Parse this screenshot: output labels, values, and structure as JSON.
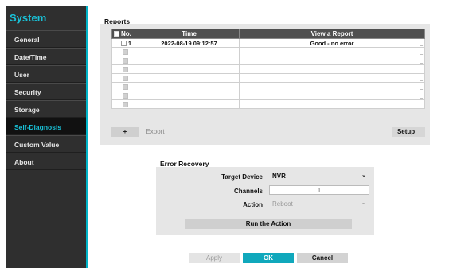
{
  "colors": {
    "accent": "#19c2d8",
    "sidebar_bg": "#2f2f2f",
    "ok_bg": "#10a8bc",
    "panel_bg": "#e6e6e6"
  },
  "sidebar": {
    "title": "System",
    "items": [
      {
        "label": "General"
      },
      {
        "label": "Date/Time"
      },
      {
        "label": "User"
      },
      {
        "label": "Security"
      },
      {
        "label": "Storage"
      },
      {
        "label": "Self-Diagnosis",
        "active": true
      },
      {
        "label": "Custom Value"
      },
      {
        "label": "About"
      }
    ]
  },
  "reports": {
    "section_label": "Reports",
    "columns": [
      "No.",
      "Time",
      "View a Report"
    ],
    "rows": [
      {
        "no": "1",
        "time": "2022-08-19 09:12:57",
        "report": "Good - no error"
      },
      {
        "no": "",
        "time": "",
        "report": ""
      },
      {
        "no": "",
        "time": "",
        "report": ""
      },
      {
        "no": "",
        "time": "",
        "report": ""
      },
      {
        "no": "",
        "time": "",
        "report": ""
      },
      {
        "no": "",
        "time": "",
        "report": ""
      },
      {
        "no": "",
        "time": "",
        "report": ""
      },
      {
        "no": "",
        "time": "",
        "report": ""
      }
    ],
    "add_label": "+",
    "export_label": "Export",
    "setup_label": "Setup"
  },
  "error_recovery": {
    "section_label": "Error Recovery",
    "target_device_label": "Target Device",
    "target_device_value": "NVR",
    "channels_label": "Channels",
    "channels_value": "1",
    "action_label": "Action",
    "action_value": "Reboot",
    "run_label": "Run the Action"
  },
  "footer": {
    "apply_label": "Apply",
    "ok_label": "OK",
    "cancel_label": "Cancel"
  }
}
